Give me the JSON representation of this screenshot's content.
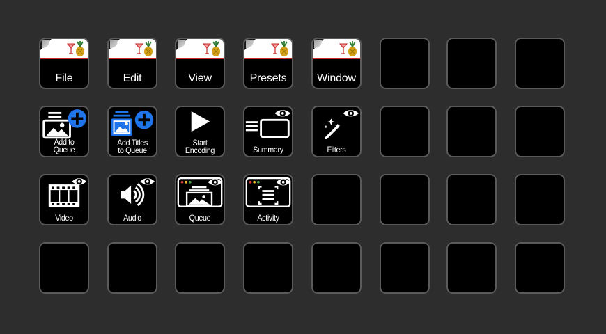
{
  "menu_keys": [
    {
      "label": "File"
    },
    {
      "label": "Edit"
    },
    {
      "label": "View"
    },
    {
      "label": "Presets"
    },
    {
      "label": "Window"
    }
  ],
  "action_keys": {
    "add_to_queue": {
      "label": "Add to Queue",
      "icon": "image-plus-icon"
    },
    "add_titles": {
      "label": "Add Titles to Queue",
      "icon": "images-plus-icon"
    },
    "start_encoding": {
      "label": "Start Encoding",
      "icon": "play-icon"
    },
    "summary": {
      "label": "Summary",
      "icon": "summary-eye-icon"
    },
    "filters": {
      "label": "Filters",
      "icon": "magic-wand-icon"
    },
    "video": {
      "label": "Video",
      "icon": "film-eye-icon"
    },
    "audio": {
      "label": "Audio",
      "icon": "speaker-eye-icon"
    },
    "queue": {
      "label": "Queue",
      "icon": "queue-window-icon"
    },
    "activity": {
      "label": "Activity",
      "icon": "activity-window-icon"
    }
  },
  "colors": {
    "background": "#2d2d2d",
    "key": "#000000",
    "key_border": "#5a5a5a",
    "accent_blue": "#1e74e8",
    "accent_red": "#c62828"
  }
}
